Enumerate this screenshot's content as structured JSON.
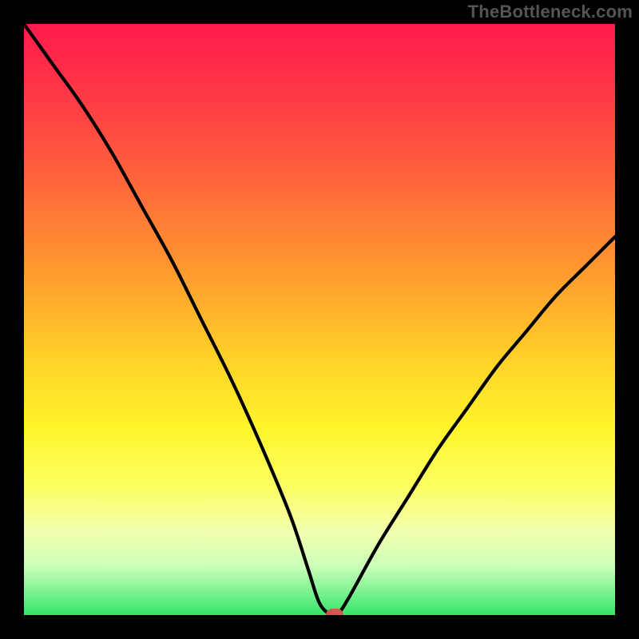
{
  "watermark": "TheBottleneck.com",
  "chart_data": {
    "type": "line",
    "title": "",
    "xlabel": "",
    "ylabel": "",
    "xlim": [
      0,
      100
    ],
    "ylim": [
      0,
      100
    ],
    "x": [
      0,
      5,
      10,
      15,
      20,
      25,
      30,
      35,
      40,
      45,
      48,
      50,
      52,
      53,
      55,
      60,
      65,
      70,
      75,
      80,
      85,
      90,
      95,
      100
    ],
    "values": [
      100,
      93,
      86,
      78,
      69,
      60,
      50,
      40,
      29,
      17,
      8,
      2,
      0,
      0,
      3,
      12,
      20,
      28,
      35,
      42,
      48,
      54,
      59,
      64
    ],
    "marker": {
      "x": 52.5,
      "y": 0
    },
    "gradient_stops": [
      {
        "pos": 0,
        "color": "#ff1b4b"
      },
      {
        "pos": 12,
        "color": "#ff3846"
      },
      {
        "pos": 28,
        "color": "#ff6a3a"
      },
      {
        "pos": 42,
        "color": "#ff9a2e"
      },
      {
        "pos": 56,
        "color": "#ffcf28"
      },
      {
        "pos": 68,
        "color": "#fff42a"
      },
      {
        "pos": 78,
        "color": "#fcff60"
      },
      {
        "pos": 86,
        "color": "#f2ffb0"
      },
      {
        "pos": 92,
        "color": "#c8ffb8"
      },
      {
        "pos": 100,
        "color": "#34e56a"
      }
    ]
  }
}
